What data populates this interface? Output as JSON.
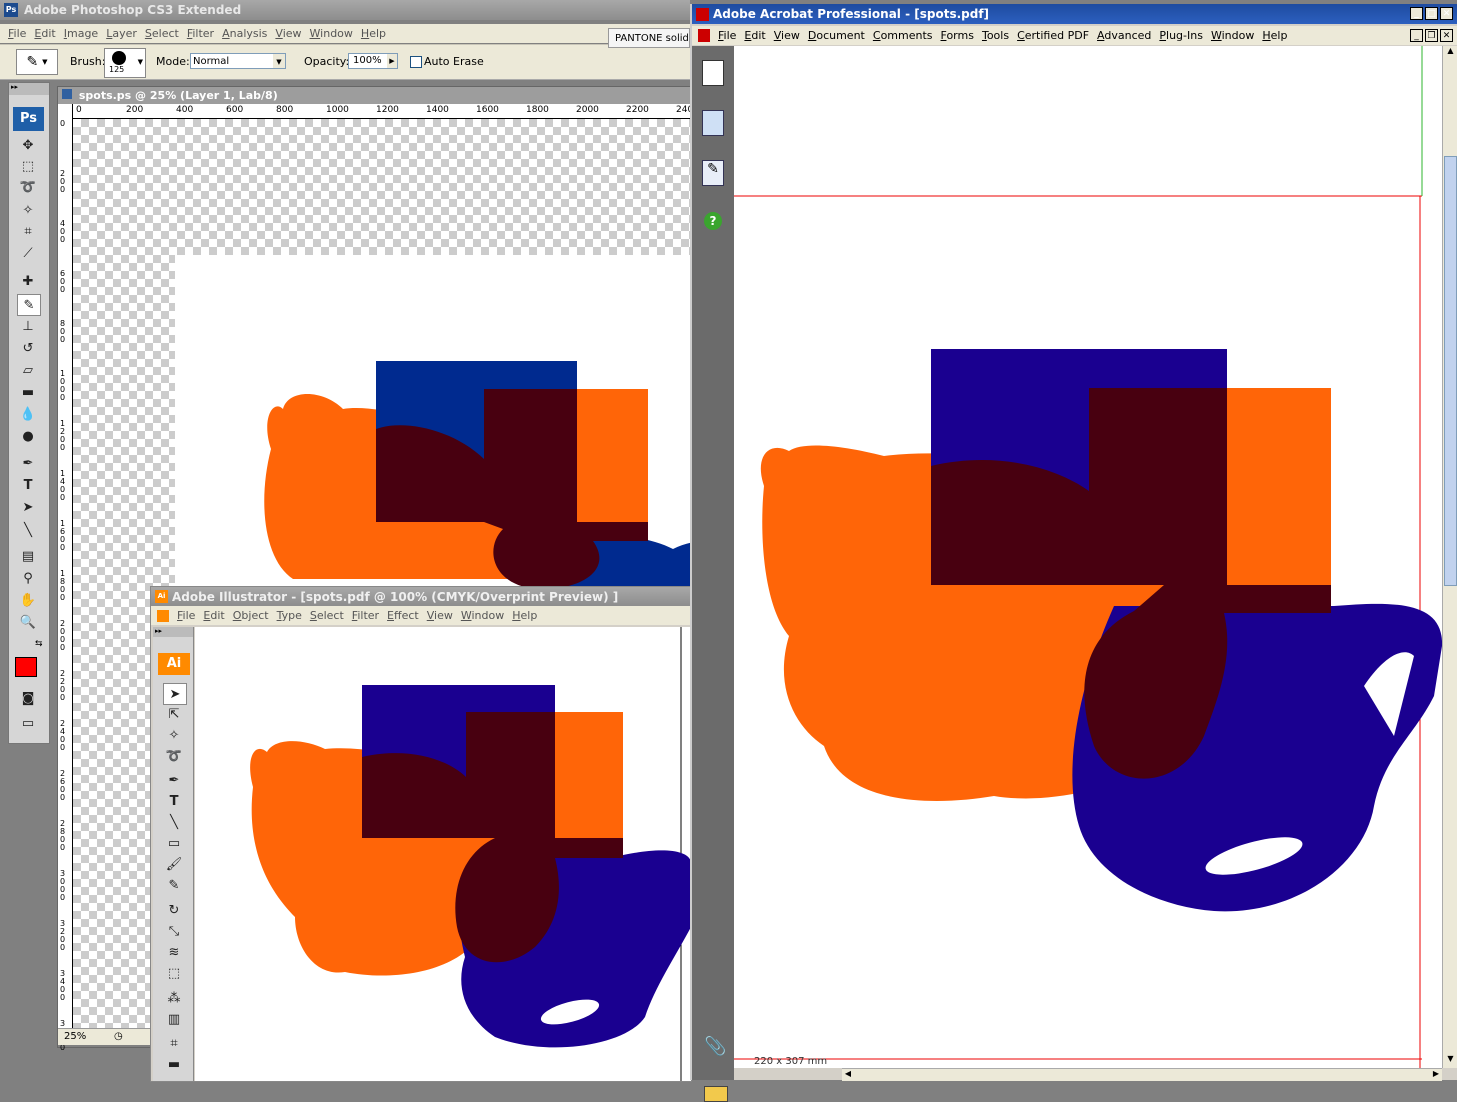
{
  "photoshop": {
    "title": "Adobe Photoshop CS3 Extended",
    "menu": [
      "File",
      "Edit",
      "Image",
      "Layer",
      "Select",
      "Filter",
      "Analysis",
      "View",
      "Window",
      "Help"
    ],
    "options": {
      "brush_label": "Brush:",
      "brush_size": "125",
      "mode_label": "Mode:",
      "mode_value": "Normal",
      "opacity_label": "Opacity:",
      "opacity_value": "100%",
      "auto_erase_label": "Auto Erase"
    },
    "pantone_tab": "PANTONE solid",
    "doc_title": "spots.ps @ 25% (Layer 1, Lab/8)",
    "ruler_top": [
      "0",
      "200",
      "400",
      "600",
      "800",
      "1000",
      "1200",
      "1400",
      "1600",
      "1800",
      "2000",
      "2200",
      "240"
    ],
    "ruler_left": [
      "0",
      "200",
      "400",
      "600",
      "800",
      "1000",
      "1200",
      "1400",
      "1600",
      "1800",
      "2000",
      "2200",
      "2400",
      "2600",
      "2800",
      "3000",
      "3200",
      "3400",
      "3600"
    ],
    "zoom": "25%",
    "ps_badge": "Ps",
    "foreground_color": "#ff0000"
  },
  "illustrator": {
    "title": "Adobe Illustrator - [spots.pdf @ 100% (CMYK/Overprint Preview) ]",
    "menu": [
      "File",
      "Edit",
      "Object",
      "Type",
      "Select",
      "Filter",
      "Effect",
      "View",
      "Window",
      "Help"
    ],
    "ai_badge": "Ai"
  },
  "acrobat": {
    "title": "Adobe Acrobat Professional - [spots.pdf]",
    "menu": [
      "File",
      "Edit",
      "View",
      "Document",
      "Comments",
      "Forms",
      "Tools",
      "Certified PDF",
      "Advanced",
      "Plug-Ins",
      "Window",
      "Help"
    ],
    "page_size": "220 x 307 mm"
  },
  "colors": {
    "orange": "#ff6508",
    "blue_ps": "#002a8f",
    "blue": "#1a0090",
    "overlap": "#480010"
  }
}
